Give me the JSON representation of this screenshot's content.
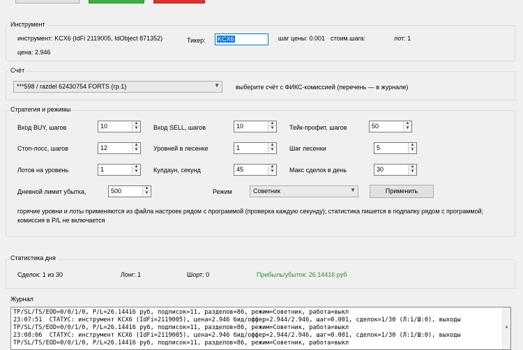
{
  "instrument": {
    "title": "Инструмент",
    "info": "инструмент: KCX6 (IdFi 2119005, IdObject 871352)",
    "ticker_label": "Тикер:",
    "ticker_value": "KCX6",
    "price_step": "шаг цены: 0.001",
    "step_cost": "стоим.шага:",
    "lot": "лот: 1",
    "price": "цена: 2.946"
  },
  "account": {
    "title": "Счёт",
    "selected": "***598 / razdel 62430754  FORTS (гр.1)",
    "hint": "выберите счёт с ФИКС-комиссией (перечень — в журнале)"
  },
  "strategy": {
    "title": "Стратегия и режимы",
    "fields": {
      "buy_label": "Вход BUY, шагов",
      "buy_value": "10",
      "sell_label": "Вход SELL, шагов",
      "sell_value": "10",
      "tp_label": "Тейк-профит, шагов",
      "tp_value": "50",
      "sl_label": "Стоп-лосс, шагов",
      "sl_value": "12",
      "levels_label": "Уровней в лесенке",
      "levels_value": "1",
      "ladder_step_label": "Шаг лесенки",
      "ladder_step_value": "5",
      "lots_label": "Лотов на уровень",
      "lots_value": "1",
      "cooldown_label": "Кулдаун, секунд",
      "cooldown_value": "45",
      "max_trades_label": "Макс сделок в день",
      "max_trades_value": "30",
      "loss_limit_label": "Дневной лимит убытка,",
      "loss_limit_value": "500",
      "mode_label": "Режим",
      "mode_value": "Советник",
      "apply_label": "Применить"
    },
    "note": "горячие уровни и лоты применяются из файла настроек рядом с программой (проверка каждую секунду); статистика пишется в подпапку рядом с программой; комиссия в P/L не включается"
  },
  "stats": {
    "title": "Статистика дня",
    "trades": "Сделок: 1 из 30",
    "long": "Лонг: 1",
    "short": "Шорт: 0",
    "pnl": "Прибыль/убыток: 26.14416 руб",
    "pnl_color": "#2e8b2e"
  },
  "journal": {
    "title": "Журнал",
    "lines": [
      "TP/SL/TS/EOD=0/0/1/0, P/L=26.14416 руб, подписок=11, разделов=86, режим=Советник, работа=выкл",
      "23:07:51  СТАТУС: инструмент KCX6 (IdFi=2119005), цена=2.946 бид/оффер=2.944/2.946, шаг=0.001, сделок=1/30 (Л:1/Ш:0), выходы",
      "TP/SL/TS/EOD=0/0/1/0, P/L=26.14416 руб, подписок=11, разделов=86, режим=Советник, работа=выкл",
      "23:08:06  СТАТУС: инструмент KCX6 (IdFi=2119005), цена=2.946 бид/оффер=2.944/2.946, шаг=0.001, сделок=1/30 (Л:1/Ш:0), выходы",
      "TP/SL/TS/EOD=0/0/1/0, P/L=26.14416 руб, подписок=11, разделов=86, режим=Советник, работа=выкл"
    ]
  },
  "colors": {
    "top_button_green": "#3cb043",
    "top_button_red": "#e03030",
    "selection": "#0078d7"
  }
}
